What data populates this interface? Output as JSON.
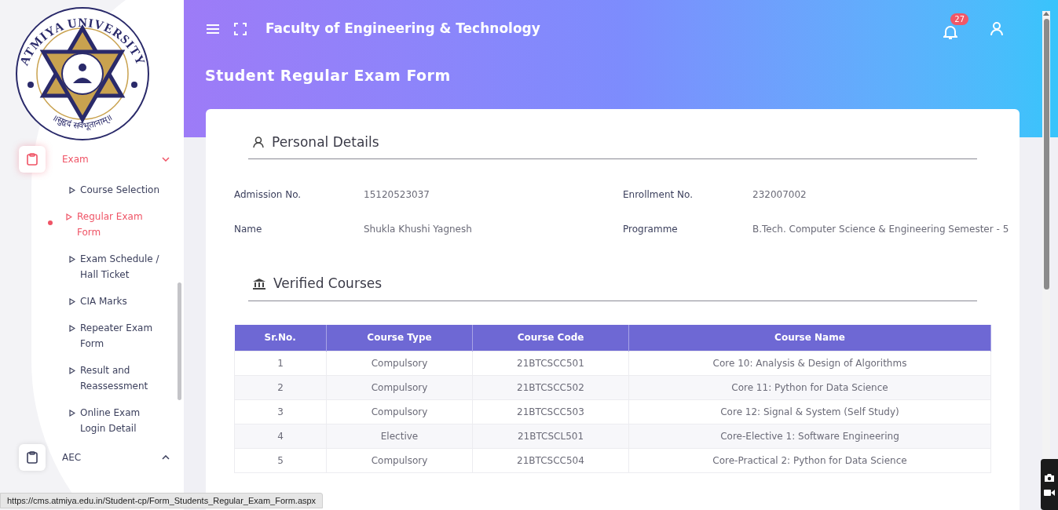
{
  "logo": {
    "name": "ATMIYA UNIVERSITY",
    "motto": "॥सुहृदं सर्वभूतानाम्॥"
  },
  "sidebar": {
    "menu": [
      {
        "label": "Exam",
        "expanded": true,
        "selected": true,
        "children": [
          {
            "label": "Course Selection",
            "selected": false
          },
          {
            "label": "Regular Exam Form",
            "selected": true
          },
          {
            "label": "Exam Schedule / Hall Ticket",
            "selected": false
          },
          {
            "label": "CIA Marks",
            "selected": false
          },
          {
            "label": "Repeater Exam Form",
            "selected": false
          },
          {
            "label": "Result and Reassessment",
            "selected": false
          },
          {
            "label": "Online Exam Login Detail",
            "selected": false
          }
        ]
      },
      {
        "label": "AEC",
        "expanded": false,
        "selected": false
      }
    ]
  },
  "header": {
    "title": "Faculty of Engineering & Technology",
    "notification_count": "27"
  },
  "page_title": "Student Regular Exam Form",
  "personal_details": {
    "heading": "Personal Details",
    "fields": [
      {
        "label": "Admission No.",
        "value": "15120523037"
      },
      {
        "label": "Enrollment No.",
        "value": "232007002"
      },
      {
        "label": "Name",
        "value": "Shukla Khushi Yagnesh"
      },
      {
        "label": "Programme",
        "value": "B.Tech. Computer Science & Engineering Semester - 5"
      }
    ]
  },
  "verified_courses": {
    "heading": "Verified Courses",
    "columns": [
      "Sr.No.",
      "Course Type",
      "Course Code",
      "Course Name"
    ],
    "rows": [
      [
        "1",
        "Compulsory",
        "21BTCSCC501",
        "Core 10: Analysis & Design of Algorithms"
      ],
      [
        "2",
        "Compulsory",
        "21BTCSCC502",
        "Core 11: Python for Data Science"
      ],
      [
        "3",
        "Compulsory",
        "21BTCSCC503",
        "Core 12: Signal & System (Self Study)"
      ],
      [
        "4",
        "Elective",
        "21BTCSCL501",
        "Core-Elective 1: Software Engineering"
      ],
      [
        "5",
        "Compulsory",
        "21BTCSCC504",
        "Core-Practical 2: Python for Data Science"
      ]
    ]
  },
  "status_bar": {
    "url": "https://cms.atmiya.edu.in/Student-cp/Form_Students_Regular_Exam_Form.aspx"
  }
}
